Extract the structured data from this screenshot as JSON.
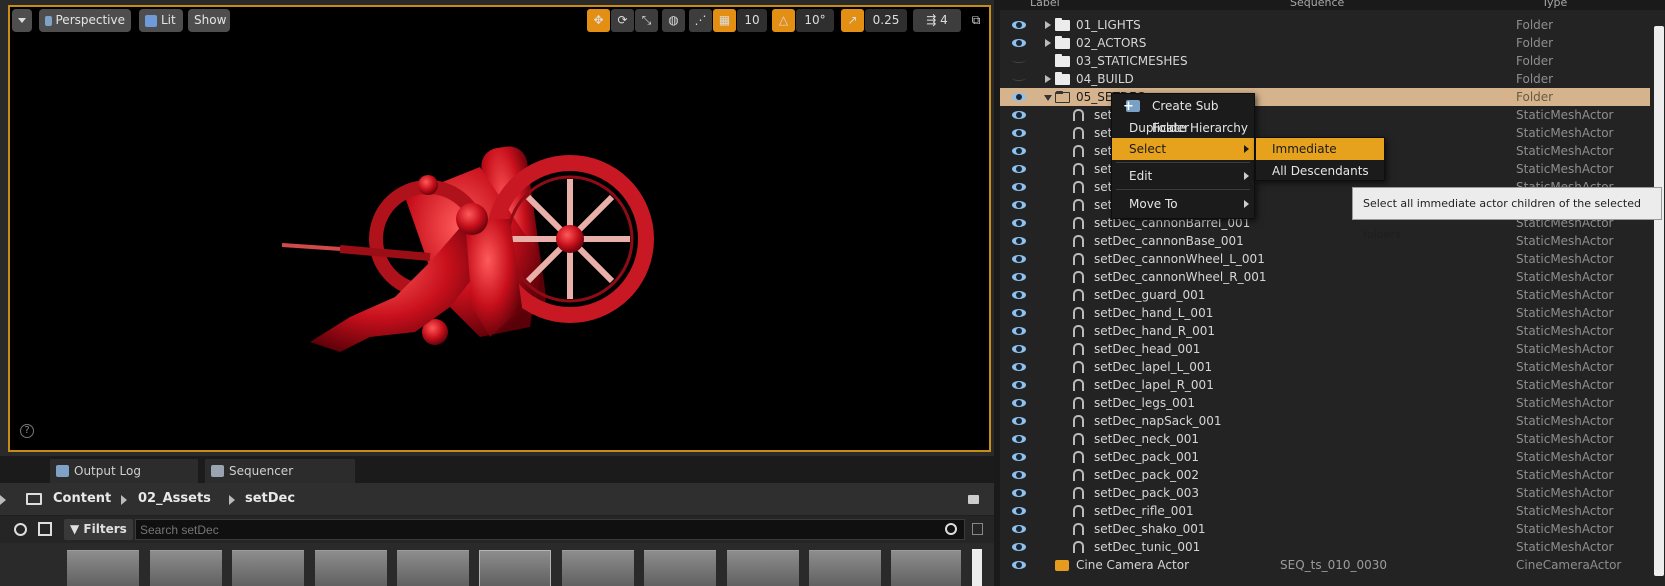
{
  "viewport": {
    "perspective_label": "Perspective",
    "lit_label": "Lit",
    "show_label": "Show",
    "grid_snap_value": "10",
    "rotation_snap_value": "10°",
    "scale_snap_value": "0.25",
    "camera_speed_value": "4",
    "help_glyph": "?"
  },
  "bottom_tabs": {
    "output_log": "Output Log",
    "sequencer": "Sequencer"
  },
  "content_browser": {
    "path": [
      "Content",
      "02_Assets",
      "setDec"
    ],
    "filters_label": "Filters",
    "search_placeholder": "Search setDec"
  },
  "outliner": {
    "header": {
      "label": "Label",
      "sequence": "Sequence",
      "type": "Type"
    },
    "rows": [
      {
        "label": "01_LIGHTS",
        "type": "Folder"
      },
      {
        "label": "02_ACTORS",
        "type": "Folder"
      },
      {
        "label": "03_STATICMESHES",
        "type": "Folder"
      },
      {
        "label": "04_BUILD",
        "type": "Folder"
      },
      {
        "label": "05_SETDEC",
        "type": "Folder"
      },
      {
        "label": "setDe",
        "type": "StaticMeshActor"
      },
      {
        "label": "setDe",
        "type": "StaticMeshActor"
      },
      {
        "label": "setDe",
        "type": "StaticMeshActor"
      },
      {
        "label": "setDe",
        "type": "StaticMeshActor"
      },
      {
        "label": "setDe",
        "type": "StaticMeshActor"
      },
      {
        "label": "setDe",
        "type": "StaticMeshActor"
      },
      {
        "label": "setDec_cannonBarrel_001",
        "type": "StaticMeshActor"
      },
      {
        "label": "setDec_cannonBase_001",
        "type": "StaticMeshActor"
      },
      {
        "label": "setDec_cannonWheel_L_001",
        "type": "StaticMeshActor"
      },
      {
        "label": "setDec_cannonWheel_R_001",
        "type": "StaticMeshActor"
      },
      {
        "label": "setDec_guard_001",
        "type": "StaticMeshActor"
      },
      {
        "label": "setDec_hand_L_001",
        "type": "StaticMeshActor"
      },
      {
        "label": "setDec_hand_R_001",
        "type": "StaticMeshActor"
      },
      {
        "label": "setDec_head_001",
        "type": "StaticMeshActor"
      },
      {
        "label": "setDec_lapel_L_001",
        "type": "StaticMeshActor"
      },
      {
        "label": "setDec_lapel_R_001",
        "type": "StaticMeshActor"
      },
      {
        "label": "setDec_legs_001",
        "type": "StaticMeshActor"
      },
      {
        "label": "setDec_napSack_001",
        "type": "StaticMeshActor"
      },
      {
        "label": "setDec_neck_001",
        "type": "StaticMeshActor"
      },
      {
        "label": "setDec_pack_001",
        "type": "StaticMeshActor"
      },
      {
        "label": "setDec_pack_002",
        "type": "StaticMeshActor"
      },
      {
        "label": "setDec_pack_003",
        "type": "StaticMeshActor"
      },
      {
        "label": "setDec_rifle_001",
        "type": "StaticMeshActor"
      },
      {
        "label": "setDec_shako_001",
        "type": "StaticMeshActor"
      },
      {
        "label": "setDec_tunic_001",
        "type": "StaticMeshActor"
      },
      {
        "label": "Cine Camera Actor",
        "sequence": "SEQ_ts_010_0030",
        "type": "CineCameraActor"
      }
    ]
  },
  "context_menu": {
    "create_sub_folder": "Create Sub Folder",
    "duplicate_hierarchy": "Duplicate Hierarchy",
    "select": "Select",
    "edit": "Edit",
    "move_to": "Move To"
  },
  "select_submenu": {
    "immediate_children": "Immediate Children",
    "all_descendants": "All Descendants"
  },
  "tooltip": "Select all immediate actor children of the selected folders",
  "colors": {
    "highlight": "#e6a21d",
    "selection_row": "#d5b48d",
    "mesh_red": "#c8101c",
    "viewport_border": "#c78e17"
  }
}
